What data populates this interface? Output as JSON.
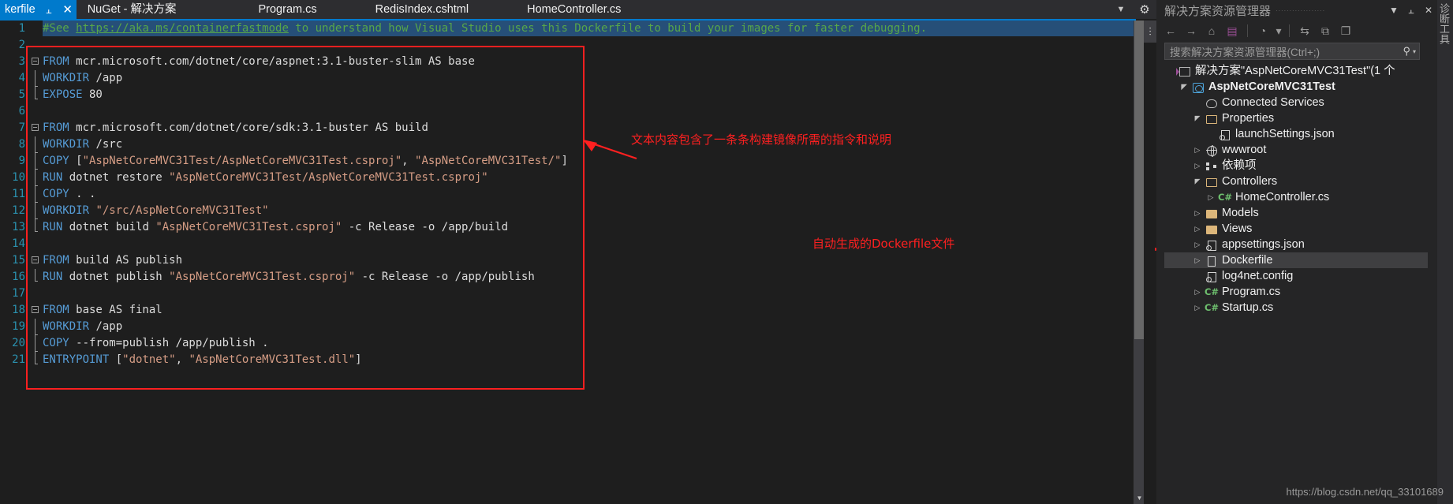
{
  "tabs": [
    {
      "label": "kerfile",
      "active": true,
      "pin": "⫠",
      "close": "✕"
    },
    {
      "label": "NuGet - 解决方案",
      "active": false
    },
    {
      "label": "Program.cs",
      "active": false
    },
    {
      "label": "RedisIndex.cshtml",
      "active": false
    },
    {
      "label": "HomeController.cs",
      "active": false
    }
  ],
  "tab_bar": {
    "overflow_chevron": "▼",
    "gear": "⚙"
  },
  "editor": {
    "split_control": "⫶",
    "scroll_up": "▲",
    "scroll_down": "▼",
    "line_count": 21,
    "line_numbers": [
      1,
      2,
      3,
      4,
      5,
      6,
      7,
      8,
      9,
      10,
      11,
      12,
      13,
      14,
      15,
      16,
      17,
      18,
      19,
      20,
      21
    ],
    "lines": [
      {
        "n": 1,
        "segs": [
          {
            "t": "#See ",
            "c": "cm"
          },
          {
            "t": "https://aka.ms/containerfastmode",
            "c": "lk"
          },
          {
            "t": " to understand how Visual Studio uses this Dockerfile to build your images for faster debugging.",
            "c": "cm"
          }
        ]
      },
      {
        "n": 2,
        "segs": []
      },
      {
        "n": 3,
        "fold": "start",
        "segs": [
          {
            "t": "FROM",
            "c": "k"
          },
          {
            "t": " mcr.microsoft.com/dotnet/core/aspnet:3.1-buster-slim AS base",
            "c": "t"
          }
        ]
      },
      {
        "n": 4,
        "fold": "mid",
        "segs": [
          {
            "t": "WORKDIR",
            "c": "k"
          },
          {
            "t": " /app",
            "c": "t"
          }
        ]
      },
      {
        "n": 5,
        "fold": "end",
        "segs": [
          {
            "t": "EXPOSE",
            "c": "k"
          },
          {
            "t": " 80",
            "c": "t"
          }
        ]
      },
      {
        "n": 6,
        "segs": []
      },
      {
        "n": 7,
        "fold": "start",
        "segs": [
          {
            "t": "FROM",
            "c": "k"
          },
          {
            "t": " mcr.microsoft.com/dotnet/core/sdk:3.1-buster AS build",
            "c": "t"
          }
        ]
      },
      {
        "n": 8,
        "fold": "mid",
        "segs": [
          {
            "t": "WORKDIR",
            "c": "k"
          },
          {
            "t": " /src",
            "c": "t"
          }
        ]
      },
      {
        "n": 9,
        "fold": "mid",
        "segs": [
          {
            "t": "COPY",
            "c": "k"
          },
          {
            "t": " [",
            "c": "t"
          },
          {
            "t": "\"AspNetCoreMVC31Test/AspNetCoreMVC31Test.csproj\"",
            "c": "s"
          },
          {
            "t": ", ",
            "c": "t"
          },
          {
            "t": "\"AspNetCoreMVC31Test/\"",
            "c": "s"
          },
          {
            "t": "]",
            "c": "t"
          }
        ]
      },
      {
        "n": 10,
        "fold": "mid",
        "segs": [
          {
            "t": "RUN",
            "c": "k"
          },
          {
            "t": " dotnet restore ",
            "c": "t"
          },
          {
            "t": "\"AspNetCoreMVC31Test/AspNetCoreMVC31Test.csproj\"",
            "c": "s"
          }
        ]
      },
      {
        "n": 11,
        "fold": "mid",
        "segs": [
          {
            "t": "COPY",
            "c": "k"
          },
          {
            "t": " . .",
            "c": "t"
          }
        ]
      },
      {
        "n": 12,
        "fold": "mid",
        "segs": [
          {
            "t": "WORKDIR",
            "c": "k"
          },
          {
            "t": " ",
            "c": "t"
          },
          {
            "t": "\"/src/AspNetCoreMVC31Test\"",
            "c": "s"
          }
        ]
      },
      {
        "n": 13,
        "fold": "end",
        "segs": [
          {
            "t": "RUN",
            "c": "k"
          },
          {
            "t": " dotnet build ",
            "c": "t"
          },
          {
            "t": "\"AspNetCoreMVC31Test.csproj\"",
            "c": "s"
          },
          {
            "t": " -c Release -o /app/build",
            "c": "t"
          }
        ]
      },
      {
        "n": 14,
        "segs": []
      },
      {
        "n": 15,
        "fold": "start",
        "segs": [
          {
            "t": "FROM",
            "c": "k"
          },
          {
            "t": " build AS publish",
            "c": "t"
          }
        ]
      },
      {
        "n": 16,
        "fold": "end",
        "segs": [
          {
            "t": "RUN",
            "c": "k"
          },
          {
            "t": " dotnet publish ",
            "c": "t"
          },
          {
            "t": "\"AspNetCoreMVC31Test.csproj\"",
            "c": "s"
          },
          {
            "t": " -c Release -o /app/publish",
            "c": "t"
          }
        ]
      },
      {
        "n": 17,
        "segs": []
      },
      {
        "n": 18,
        "fold": "start",
        "segs": [
          {
            "t": "FROM",
            "c": "k"
          },
          {
            "t": " base AS final",
            "c": "t"
          }
        ]
      },
      {
        "n": 19,
        "fold": "mid",
        "segs": [
          {
            "t": "WORKDIR",
            "c": "k"
          },
          {
            "t": " /app",
            "c": "t"
          }
        ]
      },
      {
        "n": 20,
        "fold": "mid",
        "segs": [
          {
            "t": "COPY",
            "c": "k"
          },
          {
            "t": " --from=publish /app/publish .",
            "c": "t"
          }
        ]
      },
      {
        "n": 21,
        "fold": "end",
        "segs": [
          {
            "t": "ENTRYPOINT",
            "c": "k"
          },
          {
            "t": " [",
            "c": "t"
          },
          {
            "t": "\"dotnet\"",
            "c": "s"
          },
          {
            "t": ", ",
            "c": "t"
          },
          {
            "t": "\"AspNetCoreMVC31Test.dll\"",
            "c": "s"
          },
          {
            "t": "]",
            "c": "t"
          }
        ]
      }
    ]
  },
  "annotations": {
    "color": "#ff2020",
    "text_1": "文本内容包含了一条条构建镜像所需的指令和说明",
    "text_2": "自动生成的Dockerfile文件"
  },
  "solution_explorer": {
    "title": "解决方案资源管理器",
    "title_buttons": {
      "dropdown": "▼",
      "pin": "⫠",
      "close": "✕"
    },
    "toolbar": [
      {
        "name": "back-icon",
        "glyph": "←"
      },
      {
        "name": "forward-icon",
        "glyph": "→"
      },
      {
        "name": "home-icon",
        "glyph": "⌂"
      },
      {
        "name": "vs-solution-icon",
        "glyph": "▤"
      },
      {
        "name": "pending-changes-icon",
        "glyph": "◔"
      },
      {
        "name": "pending-changes-dropdown-icon",
        "glyph": "▾"
      },
      {
        "name": "sync-icon",
        "glyph": "⇆"
      },
      {
        "name": "show-all-files-icon",
        "glyph": "⧉"
      },
      {
        "name": "properties-icon",
        "glyph": "❐"
      }
    ],
    "search": {
      "placeholder": "搜索解决方案资源管理器(Ctrl+;)",
      "icon": "⚲",
      "chevron": "▾"
    },
    "tree": [
      {
        "indent": 0,
        "twisty": "",
        "icon": "sln",
        "label": "解决方案\"AspNetCoreMVC31Test\"(1 个",
        "bold": false,
        "selected": false
      },
      {
        "indent": 1,
        "twisty": "open",
        "icon": "proj",
        "label": "AspNetCoreMVC31Test",
        "bold": true,
        "selected": false
      },
      {
        "indent": 2,
        "twisty": "",
        "icon": "cloud",
        "label": "Connected Services",
        "bold": false,
        "selected": false
      },
      {
        "indent": 2,
        "twisty": "open",
        "icon": "folder-open",
        "label": "Properties",
        "bold": false,
        "selected": false
      },
      {
        "indent": 3,
        "twisty": "",
        "icon": "json",
        "label": "launchSettings.json",
        "bold": false,
        "selected": false
      },
      {
        "indent": 2,
        "twisty": "closed",
        "icon": "globe",
        "label": "wwwroot",
        "bold": false,
        "selected": false
      },
      {
        "indent": 2,
        "twisty": "closed",
        "icon": "deps",
        "label": "依赖项",
        "bold": false,
        "selected": false
      },
      {
        "indent": 2,
        "twisty": "open",
        "icon": "folder-open",
        "label": "Controllers",
        "bold": false,
        "selected": false
      },
      {
        "indent": 3,
        "twisty": "closed",
        "icon": "cs",
        "label": "HomeController.cs",
        "bold": false,
        "selected": false
      },
      {
        "indent": 2,
        "twisty": "closed",
        "icon": "folder",
        "label": "Models",
        "bold": false,
        "selected": false
      },
      {
        "indent": 2,
        "twisty": "closed",
        "icon": "folder",
        "label": "Views",
        "bold": false,
        "selected": false
      },
      {
        "indent": 2,
        "twisty": "closed",
        "icon": "json",
        "label": "appsettings.json",
        "bold": false,
        "selected": false
      },
      {
        "indent": 2,
        "twisty": "closed",
        "icon": "doc",
        "label": "Dockerfile",
        "bold": false,
        "selected": true
      },
      {
        "indent": 2,
        "twisty": "",
        "icon": "config",
        "label": "log4net.config",
        "bold": false,
        "selected": false
      },
      {
        "indent": 2,
        "twisty": "closed",
        "icon": "cs",
        "label": "Program.cs",
        "bold": false,
        "selected": false
      },
      {
        "indent": 2,
        "twisty": "closed",
        "icon": "cs",
        "label": "Startup.cs",
        "bold": false,
        "selected": false
      }
    ]
  },
  "tool_strip": {
    "label": "诊断工具"
  },
  "watermark": "https://blog.csdn.net/qq_33101689"
}
